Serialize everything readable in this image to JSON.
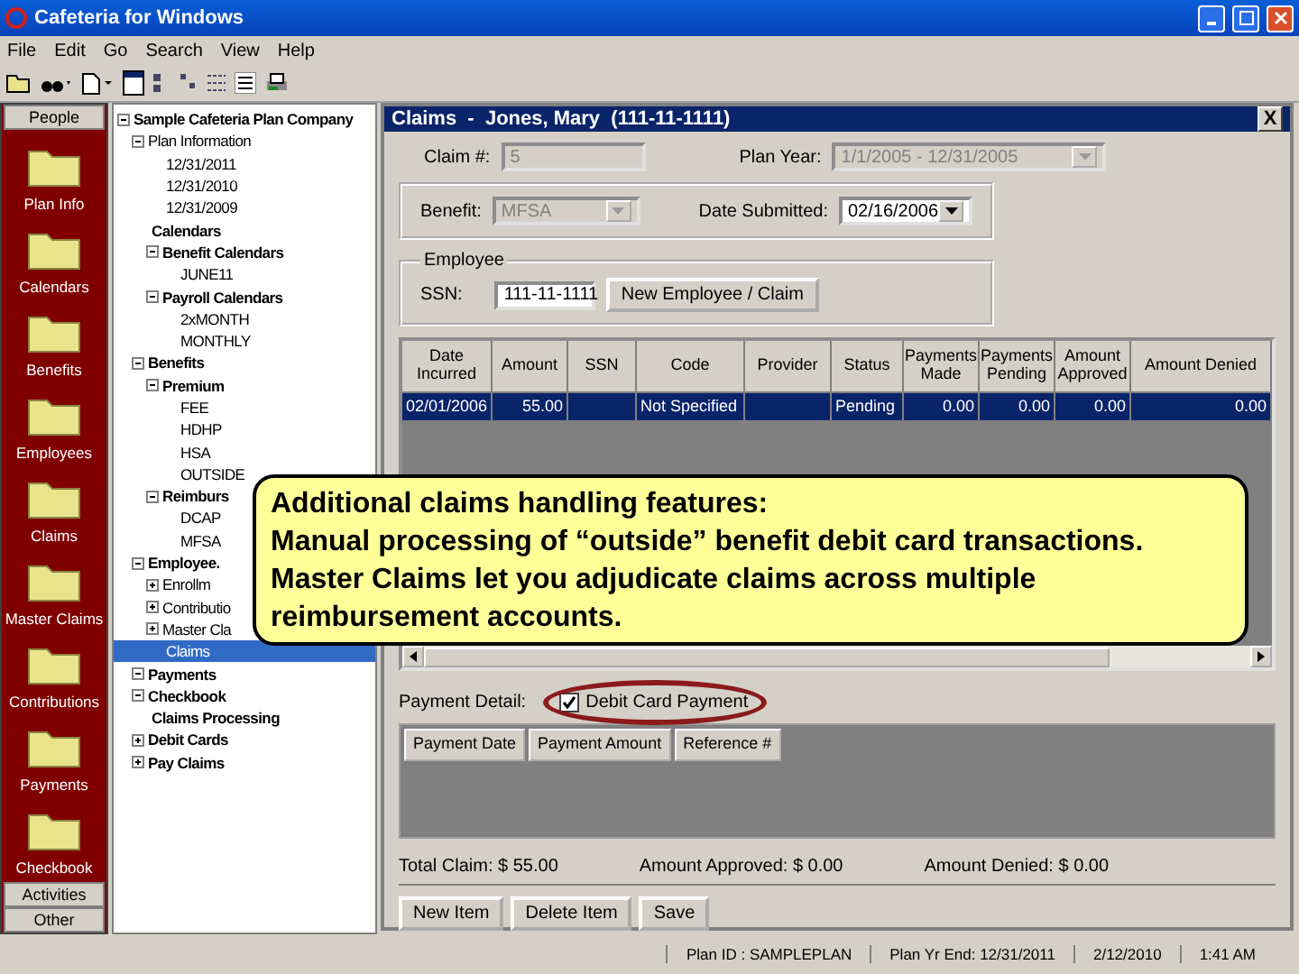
{
  "window": {
    "title": "Cafeteria for Windows"
  },
  "menu": [
    "File",
    "Edit",
    "Go",
    "Search",
    "View",
    "Help"
  ],
  "sidebar": {
    "top_tab": "People",
    "items": [
      {
        "label": "Plan Info"
      },
      {
        "label": "Calendars"
      },
      {
        "label": "Benefits"
      },
      {
        "label": "Employees"
      },
      {
        "label": "Claims"
      },
      {
        "label": "Master Claims"
      },
      {
        "label": "Contributions"
      },
      {
        "label": "Payments"
      },
      {
        "label": "Checkbook"
      }
    ],
    "bottom_tabs": [
      "Activities",
      "Other"
    ]
  },
  "tree": [
    {
      "label": "Sample Cafeteria Plan Company",
      "kind": "folder",
      "expanded": true,
      "selected": false,
      "children": [
        {
          "label": "Plan Information",
          "kind": "item",
          "expanded": true,
          "selected": false,
          "children": [
            {
              "label": "12/31/2011",
              "kind": "item",
              "selected": false
            },
            {
              "label": "12/31/2010",
              "kind": "item",
              "selected": false
            },
            {
              "label": "12/31/2009",
              "kind": "item",
              "selected": false
            }
          ]
        },
        {
          "label": "Calendars",
          "kind": "folder",
          "selected": false,
          "children": [
            {
              "label": "Benefit Calendars",
              "kind": "folder",
              "expanded": true,
              "selected": false,
              "children": [
                {
                  "label": "JUNE11",
                  "kind": "item",
                  "selected": false
                }
              ]
            },
            {
              "label": "Payroll Calendars",
              "kind": "folder",
              "expanded": true,
              "selected": false,
              "children": [
                {
                  "label": "2xMONTH",
                  "kind": "item",
                  "selected": false
                },
                {
                  "label": "MONTHLY",
                  "kind": "item",
                  "selected": false
                }
              ]
            }
          ]
        },
        {
          "label": "Benefits",
          "kind": "folder",
          "expanded": true,
          "selected": false,
          "children": [
            {
              "label": "Premium",
              "kind": "folder",
              "expanded": true,
              "selected": false,
              "children": [
                {
                  "label": "FEE",
                  "kind": "item",
                  "selected": false
                },
                {
                  "label": "HDHP",
                  "kind": "item",
                  "selected": false
                },
                {
                  "label": "HSA",
                  "kind": "item",
                  "selected": false
                },
                {
                  "label": "OUTSIDE",
                  "kind": "item",
                  "selected": false
                }
              ]
            },
            {
              "label": "Reimburs",
              "kind": "folder",
              "expanded": true,
              "selected": false,
              "children": [
                {
                  "label": "DCAP",
                  "kind": "item",
                  "selected": false
                },
                {
                  "label": "MFSA",
                  "kind": "item",
                  "selected": false
                }
              ]
            }
          ]
        },
        {
          "label": "Employee.",
          "kind": "folder",
          "expanded": true,
          "selected": false,
          "children": [
            {
              "label": "Enrollm",
              "kind": "item",
              "expanded": false,
              "selected": false
            },
            {
              "label": "Contributio",
              "kind": "item",
              "expanded": false,
              "selected": false
            },
            {
              "label": "Master Cla",
              "kind": "item",
              "expanded": false,
              "selected": false
            },
            {
              "label": "Claims",
              "kind": "item",
              "selected": true
            }
          ]
        },
        {
          "label": "Payments",
          "kind": "folder",
          "expanded": true,
          "selected": false
        },
        {
          "label": "Checkbook",
          "kind": "folder",
          "expanded": true,
          "selected": false
        },
        {
          "label": "Claims Processing",
          "kind": "folder",
          "selected": false
        },
        {
          "label": "Debit Cards",
          "kind": "folder",
          "expanded": false,
          "selected": false
        },
        {
          "label": "Pay Claims",
          "kind": "folder",
          "expanded": false,
          "selected": false
        }
      ]
    }
  ],
  "claims_window": {
    "title": "Claims  -  Jones, Mary  (111-11-1111)",
    "close": "X",
    "claim_number": {
      "label": "Claim #:",
      "value": "5",
      "disabled": true
    },
    "plan_year": {
      "label": "Plan Year:",
      "value": "1/1/2005 - 12/31/2005",
      "disabled": true
    },
    "benefit": {
      "label": "Benefit:",
      "value": "MFSA",
      "disabled": true
    },
    "date_submitted": {
      "label": "Date Submitted:",
      "value": "02/16/2006",
      "disabled": false
    },
    "employee": {
      "legend": "Employee",
      "ssn_label": "SSN:",
      "ssn": "111-11-1111",
      "button": "New Employee / Claim"
    },
    "table": {
      "columns": [
        "Date Incurred",
        "Amount",
        "SSN",
        "Code",
        "Provider",
        "Status",
        "Payments Made",
        "Payments Pending",
        "Amount Approved",
        "Amount Denied"
      ],
      "rows": [
        {
          "cells": [
            "02/01/2006",
            "55.00",
            "",
            "Not Specified",
            "",
            "Pending",
            "0.00",
            "0.00",
            "0.00",
            "0.00"
          ],
          "selected": true
        }
      ]
    },
    "payment_detail": {
      "label": "Payment Detail:",
      "checkbox": {
        "label": "Debit Card Payment",
        "checked": true
      },
      "columns": [
        "Payment Date",
        "Payment Amount",
        "Reference #"
      ]
    },
    "totals": [
      "Total Claim: $ 55.00",
      "Amount Approved: $ 0.00",
      "Amount Denied: $ 0.00"
    ],
    "buttons": [
      "New Item",
      "Delete Item",
      "Save"
    ]
  },
  "status_bar": [
    "Plan ID : SAMPLEPLAN",
    "Plan Yr End: 12/31/2011",
    "2/12/2010",
    "1:41 AM"
  ],
  "callout": {
    "title": "Additional claims handling features:",
    "points": [
      "Manual processing of “outside” benefit debit card transactions.",
      "Master Claims let you adjudicate claims across multiple reimbursement accounts."
    ]
  }
}
